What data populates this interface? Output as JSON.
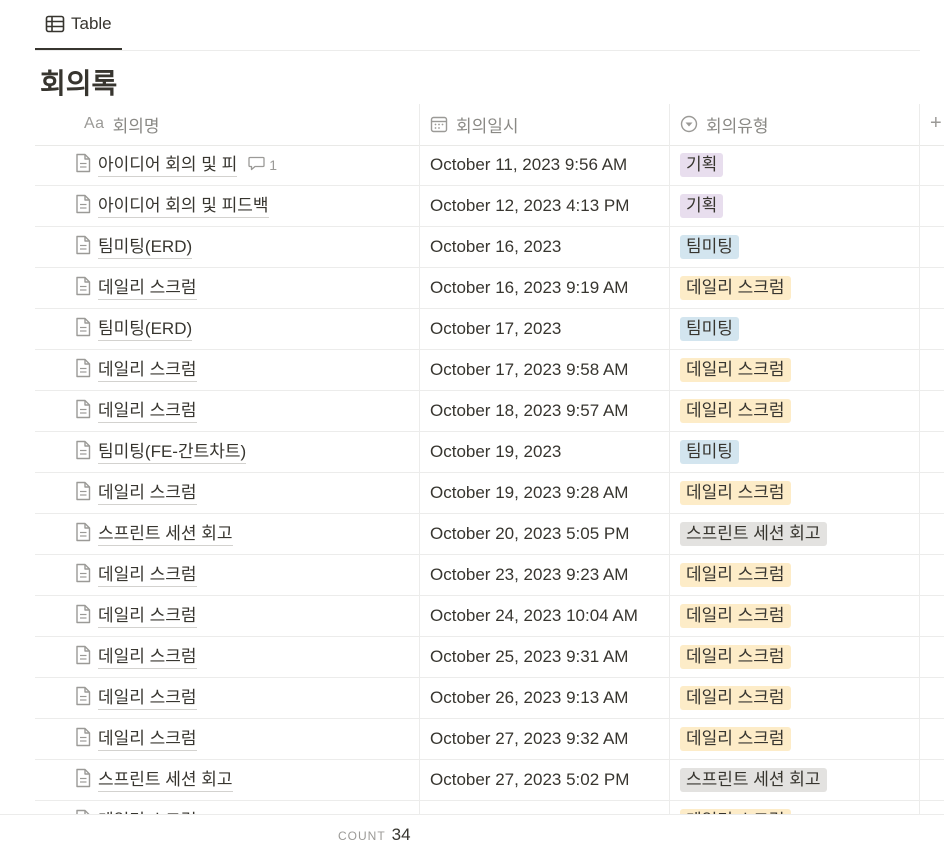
{
  "view_tab": {
    "icon": "table-icon",
    "label": "Table"
  },
  "page_title": "회의록",
  "columns": [
    {
      "icon": "text-property-icon",
      "icon_text": "Aa",
      "label": "회의명"
    },
    {
      "icon": "calendar-icon",
      "label": "회의일시"
    },
    {
      "icon": "select-property-icon",
      "label": "회의유형"
    }
  ],
  "add_column_label": "+",
  "rows": [
    {
      "name": "아이디어 회의 및 피",
      "comment_count": "1",
      "date": "October 11, 2023 9:56 AM",
      "type": "기획"
    },
    {
      "name": "아이디어 회의 및 피드백",
      "date": "October 12, 2023 4:13 PM",
      "type": "기획"
    },
    {
      "name": "팀미팅(ERD)",
      "date": "October 16, 2023",
      "type": "팀미팅"
    },
    {
      "name": "데일리 스크럼",
      "date": "October 16, 2023 9:19 AM",
      "type": "데일리 스크럼"
    },
    {
      "name": "팀미팅(ERD)",
      "date": "October 17, 2023",
      "type": "팀미팅"
    },
    {
      "name": "데일리 스크럼",
      "date": "October 17, 2023 9:58 AM",
      "type": "데일리 스크럼"
    },
    {
      "name": "데일리 스크럼",
      "date": "October 18, 2023 9:57 AM",
      "type": "데일리 스크럼"
    },
    {
      "name": "팀미팅(FE-간트차트)",
      "date": "October 19, 2023",
      "type": "팀미팅"
    },
    {
      "name": "데일리 스크럼",
      "date": "October 19, 2023 9:28 AM",
      "type": "데일리 스크럼"
    },
    {
      "name": "스프린트 세션 회고",
      "date": "October 20, 2023 5:05 PM",
      "type": "스프린트 세션 회고"
    },
    {
      "name": "데일리 스크럼",
      "date": "October 23, 2023 9:23 AM",
      "type": "데일리 스크럼"
    },
    {
      "name": "데일리 스크럼",
      "date": "October 24, 2023 10:04 AM",
      "type": "데일리 스크럼"
    },
    {
      "name": "데일리 스크럼",
      "date": "October 25, 2023 9:31 AM",
      "type": "데일리 스크럼"
    },
    {
      "name": "데일리 스크럼",
      "date": "October 26, 2023 9:13 AM",
      "type": "데일리 스크럼"
    },
    {
      "name": "데일리 스크럼",
      "date": "October 27, 2023 9:32 AM",
      "type": "데일리 스크럼"
    },
    {
      "name": "스프린트 세션 회고",
      "date": "October 27, 2023 5:02 PM",
      "type": "스프린트 세션 회고"
    },
    {
      "name": "데일리 스크럼",
      "date": "",
      "type": "데일리 스크럼"
    }
  ],
  "tag_colors": {
    "기획": "#e8deee",
    "팀미팅": "#d3e5ef",
    "데일리 스크럼": "#fdecc8",
    "스프린트 세션 회고": "#e3e2e0"
  },
  "footer": {
    "count_label": "COUNT",
    "count_value": "34"
  }
}
